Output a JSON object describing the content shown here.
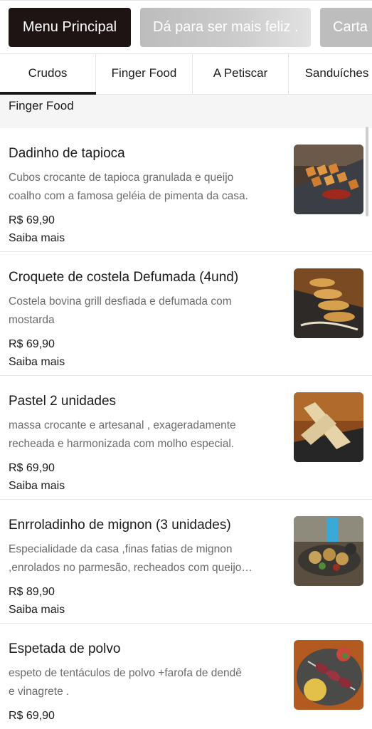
{
  "top_nav": {
    "pills": [
      "Menu Principal",
      "Dá para ser mais feliz .",
      "Carta de"
    ]
  },
  "category_tabs": [
    "Crudos",
    "Finger Food",
    "A Petiscar",
    "Sanduíches"
  ],
  "section": {
    "title": "Finger Food"
  },
  "items": [
    {
      "name": "Dadinho de tapioca",
      "description_lines": [
        "Cubos crocante de tapioca granulada e queijo",
        "coalho com a famosa geléia de pimenta da casa."
      ],
      "price": "R$ 69,90",
      "more_label": "Saiba mais"
    },
    {
      "name": "Croquete de costela Defumada (4und)",
      "description_lines": [
        "Costela bovina grill desfiada e defumada com",
        "mostarda"
      ],
      "price": "R$ 69,90",
      "more_label": "Saiba mais"
    },
    {
      "name": "Pastel 2 unidades",
      "description_lines": [
        "massa crocante e artesanal , exageradamente",
        "recheada e harmonizada com molho especial."
      ],
      "price": "R$ 69,90",
      "more_label": "Saiba mais"
    },
    {
      "name": "Enrroladinho de mignon (3 unidades)",
      "description_lines": [
        "Especialidade da casa ,finas fatias de mignon",
        ",enrolados no parmesão, recheados com queijo…"
      ],
      "price": "R$ 89,90",
      "more_label": "Saiba mais"
    },
    {
      "name": "Espetada de polvo",
      "description_lines": [
        "espeto de tentáculos de polvo +farofa de dendê",
        "e vinagrete ."
      ],
      "price": "R$ 69,90",
      "more_label": ""
    }
  ],
  "colors": {
    "active_pill": "#1e1414",
    "inactive_pill": "#bdbdbd",
    "section_header_bg": "#f5f5f5",
    "description_text": "#6b6b6b"
  }
}
